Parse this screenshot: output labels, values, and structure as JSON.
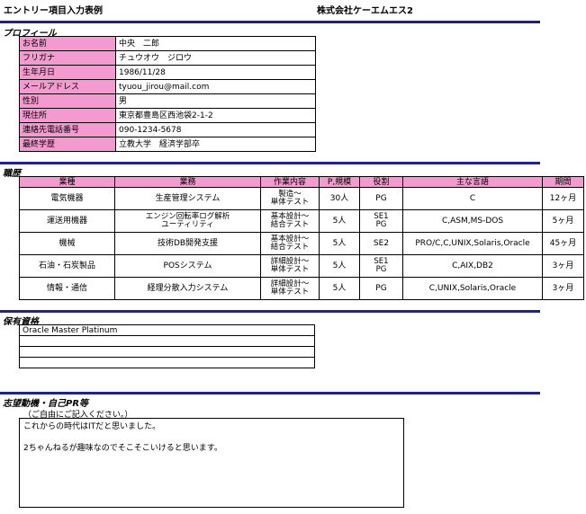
{
  "header": {
    "form_title": "エントリー項目入力表例",
    "company": "株式会社ケーエムエス2"
  },
  "sections": {
    "profile": "プロフィール",
    "career": "職歴",
    "qualifications": "保有資格",
    "motivation": "志望動機・自己PR等"
  },
  "profile": {
    "rows": [
      {
        "label": "お名前",
        "value": "中央　二郎"
      },
      {
        "label": "フリガナ",
        "value": "チュウオウ　ジロウ"
      },
      {
        "label": "生年月日",
        "value": "1986/11/28"
      },
      {
        "label": "メールアドレス",
        "value": "tyuou_jirou@mail.com"
      },
      {
        "label": "性別",
        "value": "男"
      },
      {
        "label": "現住所",
        "value": "東京都豊島区西池袋2-1-2"
      },
      {
        "label": "連絡先電話番号",
        "value": "090-1234-5678"
      },
      {
        "label": "最終学歴",
        "value": "立教大学　経済学部卒"
      }
    ]
  },
  "career": {
    "headers": [
      "業種",
      "業務",
      "作業内容",
      "P,規模",
      "役割",
      "主な言語",
      "期間"
    ],
    "rows": [
      {
        "industry": "電気機器",
        "task": "生産管理システム",
        "work1": "製造～",
        "work2": "単体テスト",
        "scale": "30人",
        "role1": "PG",
        "role2": "",
        "lang": "C",
        "period": "12ヶ月"
      },
      {
        "industry": "運送用機器",
        "task": "エンジン回転率ログ解析ユーティリティ",
        "task1": "エンジン回転率ログ解析",
        "task2": "ユーティリティ",
        "work1": "基本設計～",
        "work2": "結合テスト",
        "scale": "5人",
        "role1": "SE1",
        "role2": "PG",
        "lang": "C,ASM,MS-DOS",
        "period": "5ヶ月"
      },
      {
        "industry": "機械",
        "task": "技術DB開発支援",
        "work1": "基本設計～",
        "work2": "結合テスト",
        "scale": "5人",
        "role1": "SE2",
        "role2": "",
        "lang": "PRO/C,C,UNIX,Solaris,Oracle",
        "period": "45ヶ月"
      },
      {
        "industry": "石油・石炭製品",
        "task": "POSシステム",
        "work1": "詳細設計～",
        "work2": "単体テスト",
        "scale": "5人",
        "role1": "SE1",
        "role2": "PG",
        "lang": "C,AIX,DB2",
        "period": "3ヶ月"
      },
      {
        "industry": "情報・通信",
        "task": "経理分散入力システム",
        "work1": "詳細設計～",
        "work2": "単体テスト",
        "scale": "5人",
        "role1": "PG",
        "role2": "",
        "lang": "C,UNIX,Solaris,Oracle",
        "period": "3ヶ月"
      }
    ]
  },
  "qualifications": {
    "rows": [
      "Oracle Master Platinum",
      "",
      "",
      ""
    ]
  },
  "motivation": {
    "note": "（ご自由にご記入ください。）",
    "line1": "これからの時代はITだと思いました。",
    "line2": "2ちゃんねるが趣味なのでそこそこいけると思います。"
  },
  "colors": {
    "rule": "#1f1f9c",
    "label_bg": "#f59ad0"
  }
}
